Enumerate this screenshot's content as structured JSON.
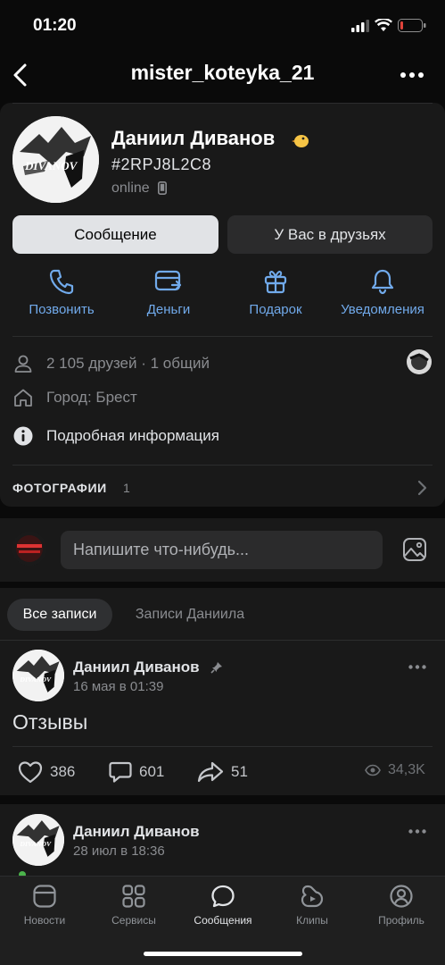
{
  "status_bar": {
    "time": "01:20"
  },
  "header": {
    "title": "mister_koteyka_21"
  },
  "profile": {
    "name": "Даниил Диванов",
    "id": "#2RPJ8L2C8",
    "status": "online",
    "avatar_text": "DIVANOV"
  },
  "buttons": {
    "message": "Сообщение",
    "friends": "У Вас в друзьях"
  },
  "actions": [
    {
      "label": "Позвонить",
      "icon": "phone-icon"
    },
    {
      "label": "Деньги",
      "icon": "money-icon"
    },
    {
      "label": "Подарок",
      "icon": "gift-icon"
    },
    {
      "label": "Уведомления",
      "icon": "bell-icon"
    }
  ],
  "info": {
    "friends": "2 105 друзей · 1 общий",
    "city": "Город: Брест",
    "details": "Подробная информация"
  },
  "photos": {
    "label": "ФОТОГРАФИИ",
    "count": "1"
  },
  "compose": {
    "placeholder": "Напишите что-нибудь..."
  },
  "wall_tabs": {
    "all": "Все записи",
    "owner": "Записи Даниила"
  },
  "posts": [
    {
      "author": "Даниил Диванов",
      "date": "16 мая в 01:39",
      "text": "Отзывы",
      "likes": "386",
      "comments": "601",
      "shares": "51",
      "views": "34,3K",
      "pinned": true
    },
    {
      "author": "Даниил Диванов",
      "date": "28 июл в 18:36"
    }
  ],
  "tabbar": [
    {
      "label": "Новости",
      "icon": "news-icon"
    },
    {
      "label": "Сервисы",
      "icon": "services-icon"
    },
    {
      "label": "Сообщения",
      "icon": "messages-icon",
      "active": true
    },
    {
      "label": "Клипы",
      "icon": "clips-icon"
    },
    {
      "label": "Профиль",
      "icon": "profile-icon"
    }
  ],
  "colors": {
    "accent": "#71aaeb",
    "background": "#0a0a0a",
    "card": "#191919"
  }
}
